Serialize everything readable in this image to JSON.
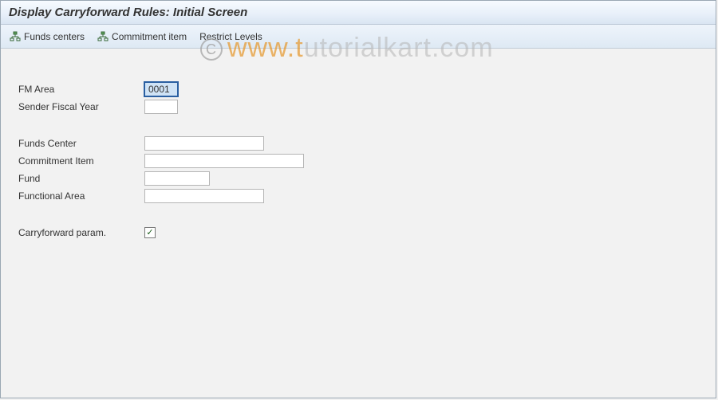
{
  "header": {
    "title": "Display Carryforward Rules: Initial Screen"
  },
  "toolbar": {
    "funds_centers": "Funds centers",
    "commitment_item": "Commitment item",
    "restrict_levels": "Restrict Levels"
  },
  "form": {
    "fm_area": {
      "label": "FM Area",
      "value": "0001"
    },
    "sender_fy": {
      "label": "Sender Fiscal Year",
      "value": ""
    },
    "funds_center": {
      "label": "Funds Center",
      "value": ""
    },
    "commitment_item": {
      "label": "Commitment Item",
      "value": ""
    },
    "fund": {
      "label": "Fund",
      "value": ""
    },
    "functional_area": {
      "label": "Functional Area",
      "value": ""
    },
    "carryforward_param": {
      "label": "Carryforward param.",
      "checked": true
    }
  },
  "watermark": {
    "prefix": "© ",
    "orange": "www.t",
    "rest": "utorialkart.com"
  }
}
